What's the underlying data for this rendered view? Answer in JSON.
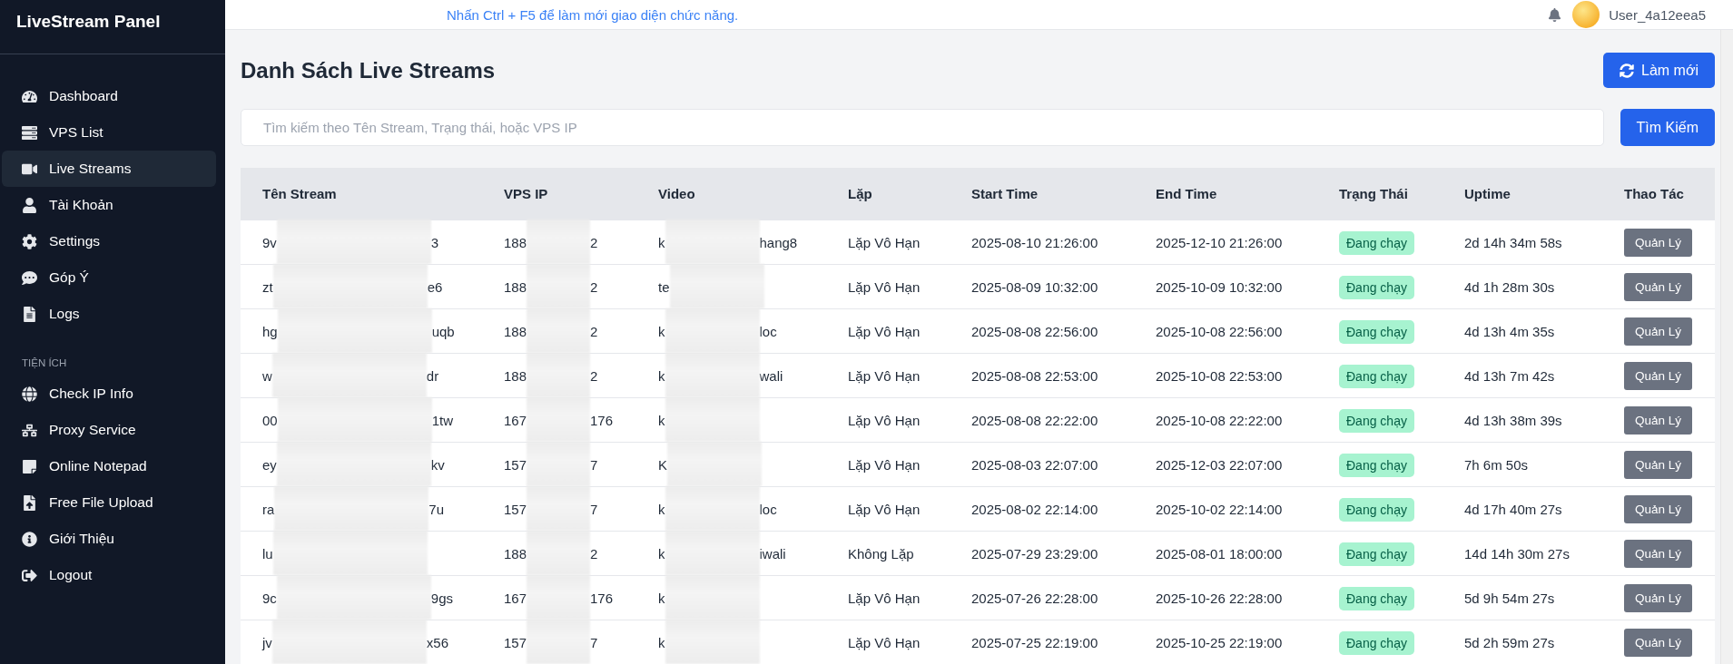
{
  "sidebar": {
    "brand": "LiveStream Panel",
    "items": [
      {
        "label": "Dashboard",
        "selected": false
      },
      {
        "label": "VPS List",
        "selected": false
      },
      {
        "label": "Live Streams",
        "selected": true
      },
      {
        "label": "Tài Khoản",
        "selected": false
      },
      {
        "label": "Settings",
        "selected": false
      },
      {
        "label": "Góp Ý",
        "selected": false
      },
      {
        "label": "Logs",
        "selected": false
      }
    ],
    "section_title": "TIỆN ÍCH",
    "tools": [
      {
        "label": "Check IP Info",
        "selected": false
      },
      {
        "label": "Proxy Service",
        "selected": false
      },
      {
        "label": "Online Notepad",
        "selected": false
      },
      {
        "label": "Free File Upload",
        "selected": false
      },
      {
        "label": "Giới Thiệu",
        "selected": false
      },
      {
        "label": "Logout",
        "selected": false
      }
    ]
  },
  "topbar": {
    "notice": "Nhấn Ctrl + F5 để làm mới giao diện chức năng.",
    "username": "User_4a12eea5"
  },
  "page_title": "Danh Sách Live Streams",
  "refresh_button": "Làm mới",
  "search": {
    "placeholder": "Tìm kiếm theo Tên Stream, Trạng thái, hoặc VPS IP",
    "button": "Tìm Kiếm"
  },
  "table": {
    "columns": [
      "Tên Stream",
      "VPS IP",
      "Video",
      "Lặp",
      "Start Time",
      "End Time",
      "Trạng Thái",
      "Uptime",
      "Thao Tác"
    ],
    "rows": [
      {
        "name": {
          "start": "9v",
          "end": "3"
        },
        "ip": {
          "start": "188",
          "end": "2"
        },
        "video": {
          "start": "k",
          "end": "hang8"
        },
        "loop": "Lặp Vô Hạn",
        "start": "2025-08-10 21:26:00",
        "end": "2025-12-10 21:26:00",
        "status": "Đang chạy",
        "uptime": "2d 14h 34m 58s",
        "action": "Quản Lý"
      },
      {
        "name": {
          "start": "zt",
          "end": "e6"
        },
        "ip": {
          "start": "188",
          "end": "2"
        },
        "video": {
          "start": "te"
        },
        "loop": "Lặp Vô Hạn",
        "start": "2025-08-09 10:32:00",
        "end": "2025-10-09 10:32:00",
        "status": "Đang chạy",
        "uptime": "4d 1h 28m 30s",
        "action": "Quản Lý"
      },
      {
        "name": {
          "start": "hg",
          "end": "uqb"
        },
        "ip": {
          "start": "188",
          "end": "2"
        },
        "video": {
          "start": "k",
          "end": "loc"
        },
        "loop": "Lặp Vô Hạn",
        "start": "2025-08-08 22:56:00",
        "end": "2025-10-08 22:56:00",
        "status": "Đang chạy",
        "uptime": "4d 13h 4m 35s",
        "action": "Quản Lý"
      },
      {
        "name": {
          "start": "w",
          "end": "dr"
        },
        "ip": {
          "start": "188",
          "end": "2"
        },
        "video": {
          "start": "k",
          "end": "wali"
        },
        "loop": "Lặp Vô Hạn",
        "start": "2025-08-08 22:53:00",
        "end": "2025-10-08 22:53:00",
        "status": "Đang chạy",
        "uptime": "4d 13h 7m 42s",
        "action": "Quản Lý"
      },
      {
        "name": {
          "start": "00",
          "end": "1tw"
        },
        "ip": {
          "start": "167",
          "end": "176"
        },
        "video": {
          "start": "k"
        },
        "loop": "Lặp Vô Hạn",
        "start": "2025-08-08 22:22:00",
        "end": "2025-10-08 22:22:00",
        "status": "Đang chạy",
        "uptime": "4d 13h 38m 39s",
        "action": "Quản Lý"
      },
      {
        "name": {
          "start": "ey",
          "end": "kv"
        },
        "ip": {
          "start": "157",
          "end": "7"
        },
        "video": {
          "start": "K"
        },
        "loop": "Lặp Vô Hạn",
        "start": "2025-08-03 22:07:00",
        "end": "2025-12-03 22:07:00",
        "status": "Đang chạy",
        "uptime": "7h 6m 50s",
        "action": "Quản Lý"
      },
      {
        "name": {
          "start": "ra",
          "end": "7u"
        },
        "ip": {
          "start": "157",
          "end": "7"
        },
        "video": {
          "start": "k",
          "end": "loc"
        },
        "loop": "Lặp Vô Hạn",
        "start": "2025-08-02 22:14:00",
        "end": "2025-10-02 22:14:00",
        "status": "Đang chạy",
        "uptime": "4d 17h 40m 27s",
        "action": "Quản Lý"
      },
      {
        "name": {
          "start": "lu"
        },
        "ip": {
          "start": "188",
          "end": "2"
        },
        "video": {
          "start": "k",
          "end": "iwali"
        },
        "loop": "Không Lặp",
        "start": "2025-07-29 23:29:00",
        "end": "2025-08-01 18:00:00",
        "status": "Đang chạy",
        "uptime": "14d 14h 30m 27s",
        "action": "Quản Lý"
      },
      {
        "name": {
          "start": "9c",
          "end": "9gs"
        },
        "ip": {
          "start": "167",
          "end": "176"
        },
        "video": {
          "start": "k"
        },
        "loop": "Lặp Vô Hạn",
        "start": "2025-07-26 22:28:00",
        "end": "2025-10-26 22:28:00",
        "status": "Đang chạy",
        "uptime": "5d 9h 54m 27s",
        "action": "Quản Lý"
      },
      {
        "name": {
          "start": "jv",
          "end": "x56"
        },
        "ip": {
          "start": "157",
          "end": "7"
        },
        "video": {
          "start": "k"
        },
        "loop": "Lặp Vô Hạn",
        "start": "2025-07-25 22:19:00",
        "end": "2025-10-25 22:19:00",
        "status": "Đang chạy",
        "uptime": "5d 2h 59m 27s",
        "action": "Quản Lý"
      }
    ]
  }
}
